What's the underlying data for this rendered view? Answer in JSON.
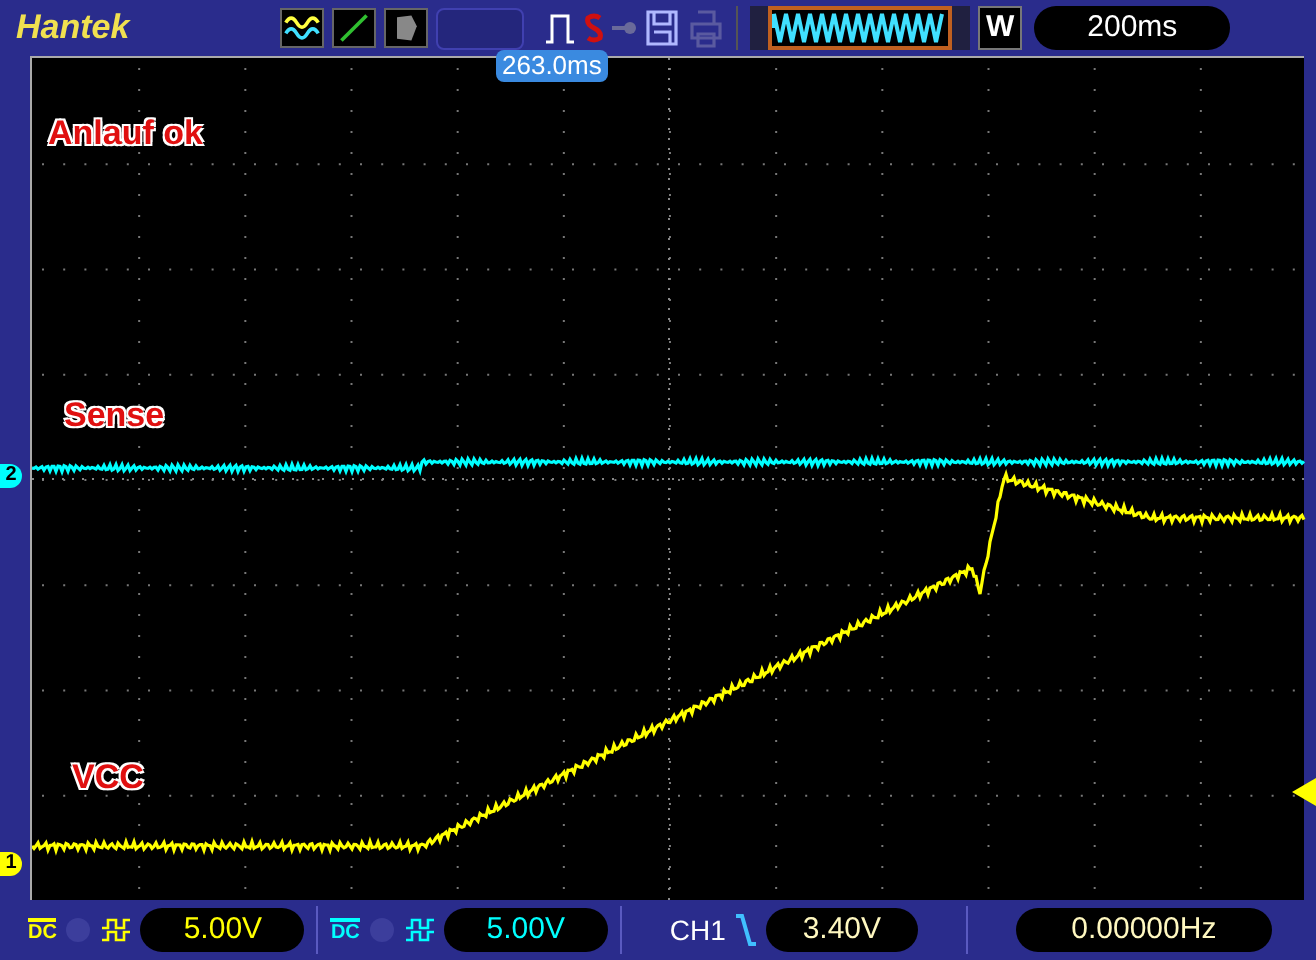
{
  "brand": "Hantek",
  "trigger_time": "263.0ms",
  "window_button": "W",
  "timebase": "200ms",
  "annotations": [
    {
      "text": "Anlauf ok"
    },
    {
      "text": "Sense"
    },
    {
      "text": "VCC"
    }
  ],
  "markers": [
    {
      "label": "2",
      "color": "#00ffff"
    },
    {
      "label": "1",
      "color": "#ffff00"
    }
  ],
  "channels": [
    {
      "coupling": "DC",
      "volts_div": "5.00V",
      "color": "#ffff00"
    },
    {
      "coupling": "DC",
      "volts_div": "5.00V",
      "color": "#00ffff"
    }
  ],
  "trigger": {
    "source": "CH1",
    "level": "3.40V"
  },
  "frequency": "0.00000Hz"
}
